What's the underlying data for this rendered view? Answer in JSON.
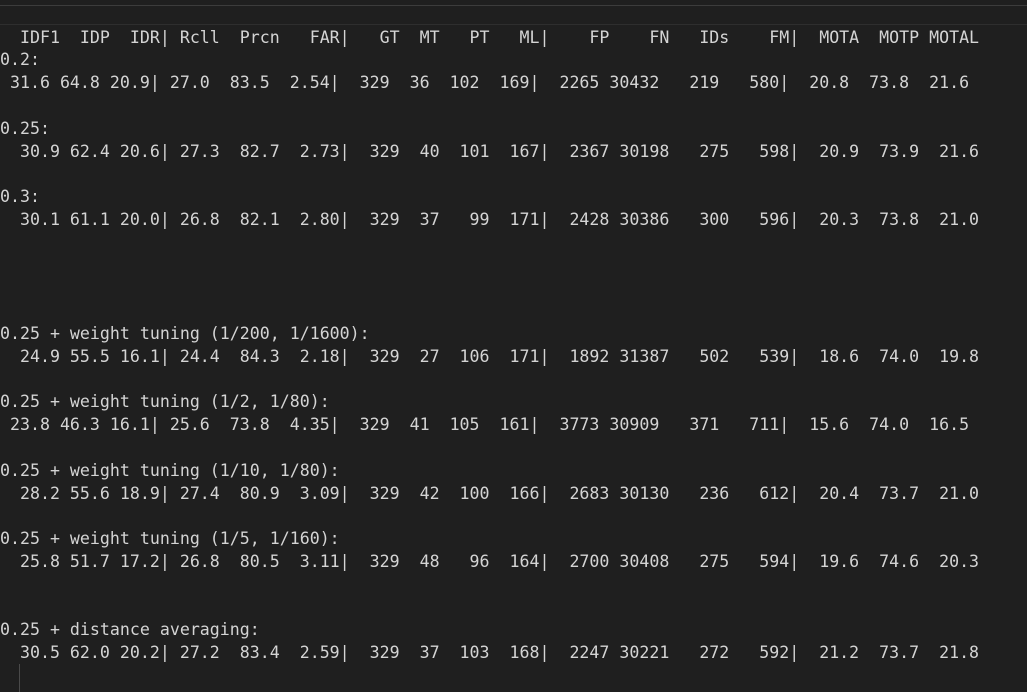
{
  "editor": {
    "lines": [
      "  IDF1  IDP  IDR| Rcll  Prcn   FAR|   GT  MT   PT   ML|    FP    FN   IDs    FM|  MOTA  MOTP MOTAL",
      "0.2:",
      " 31.6 64.8 20.9| 27.0  83.5  2.54|  329  36  102  169|  2265 30432   219   580|  20.8  73.8  21.6",
      "",
      "0.25:",
      "  30.9 62.4 20.6| 27.3  82.7  2.73|  329  40  101  167|  2367 30198   275   598|  20.9  73.9  21.6",
      "",
      "0.3:",
      "  30.1 61.1 20.0| 26.8  82.1  2.80|  329  37   99  171|  2428 30386   300   596|  20.3  73.8  21.0",
      "0.25 + weight tuning (1/200, 1/1600):",
      "  24.9 55.5 16.1| 24.4  84.3  2.18|  329  27  106  171|  1892 31387   502   539|  18.6  74.0  19.8",
      "",
      "0.25 + weight tuning (1/2, 1/80):",
      " 23.8 46.3 16.1| 25.6  73.8  4.35|  329  41  105  161|  3773 30909   371   711|  15.6  74.0  16.5",
      "",
      "0.25 + weight tuning (1/10, 1/80):",
      "  28.2 55.6 18.9| 27.4  80.9  3.09|  329  42  100  166|  2683 30130   236   612|  20.4  73.7  21.0",
      "",
      "0.25 + weight tuning (1/5, 1/160):",
      "  25.8 51.7 17.2| 26.8  80.5  3.11|  329  48   96  164|  2700 30408   275   594|  19.6  74.6  20.3",
      "0.25 + distance averaging:",
      "  30.5 62.0 20.2| 27.2  83.4  2.59|  329  37  103  168|  2247 30221   272   592|  21.2  73.7  21.8"
    ]
  },
  "colors": {
    "background": "#1f1f1f",
    "text": "#d4d4d4"
  }
}
